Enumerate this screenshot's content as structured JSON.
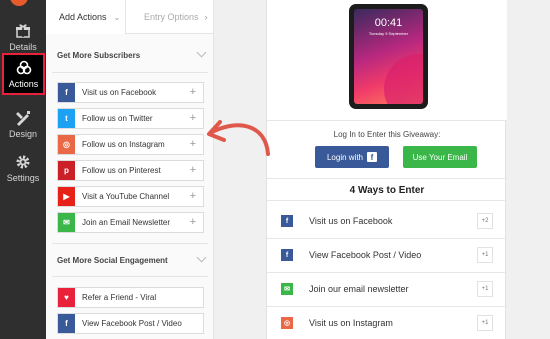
{
  "colors": {
    "facebook": "#3a5998",
    "twitter": "#1da1f2",
    "instagram": "#ea6845",
    "pinterest": "#cb2027",
    "youtube": "#e62117",
    "email": "#3bb649",
    "referral": "#e8223a",
    "accent_red": "#e8223a",
    "arrow": "#e0574b"
  },
  "rail": {
    "items": [
      {
        "label": "Details",
        "icon": "gift-icon"
      },
      {
        "label": "Actions",
        "icon": "actions-icon"
      },
      {
        "label": "Design",
        "icon": "design-icon"
      },
      {
        "label": "Settings",
        "icon": "gear-icon"
      }
    ]
  },
  "panel": {
    "tabs": {
      "add_actions": "Add Actions",
      "entry_options": "Entry Options"
    },
    "section1": {
      "title": "Get More Subscribers",
      "actions": [
        {
          "label": "Visit us on Facebook",
          "icon": "facebook-icon",
          "glyph": "f"
        },
        {
          "label": "Follow us on Twitter",
          "icon": "twitter-icon",
          "glyph": "t"
        },
        {
          "label": "Follow us on Instagram",
          "icon": "instagram-icon",
          "glyph": "◎"
        },
        {
          "label": "Follow us on Pinterest",
          "icon": "pinterest-icon",
          "glyph": "p"
        },
        {
          "label": "Visit a YouTube Channel",
          "icon": "youtube-icon",
          "glyph": "▶"
        },
        {
          "label": "Join an Email Newsletter",
          "icon": "email-icon",
          "glyph": "✉"
        }
      ]
    },
    "section2": {
      "title": "Get More Social Engagement",
      "actions": [
        {
          "label": "Refer a Friend - Viral",
          "icon": "heart-icon",
          "glyph": "♥"
        },
        {
          "label": "View Facebook Post / Video",
          "icon": "facebook-icon",
          "glyph": "f"
        }
      ]
    },
    "plus": "+"
  },
  "preview": {
    "tablet": {
      "time": "00:41",
      "date": "Tuesday 9 September"
    },
    "login_prompt": "Log In to Enter this Giveaway:",
    "login_fb": "Login with",
    "login_fb_glyph": "f",
    "login_email": "Use Your Email",
    "ways_title": "4 Ways to Enter",
    "entries": [
      {
        "label": "Visit us on Facebook",
        "points": "+2",
        "icon": "facebook-icon",
        "glyph": "f"
      },
      {
        "label": "View Facebook Post / Video",
        "points": "+1",
        "icon": "facebook-icon",
        "glyph": "f"
      },
      {
        "label": "Join our email newsletter",
        "points": "+1",
        "icon": "email-icon",
        "glyph": "✉"
      },
      {
        "label": "Visit us on Instagram",
        "points": "+1",
        "icon": "instagram-icon",
        "glyph": "◎"
      }
    ]
  }
}
